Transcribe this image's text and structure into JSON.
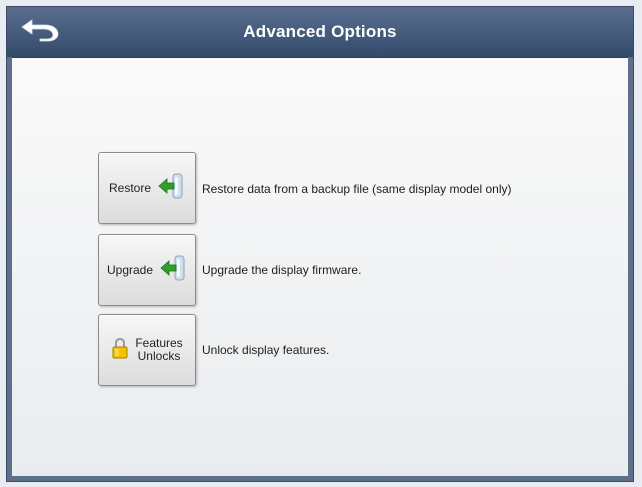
{
  "header": {
    "title": "Advanced Options",
    "back_icon": "back-arrow-icon"
  },
  "options": [
    {
      "label": "Restore",
      "icon": "import-arrow-icon",
      "description": "Restore data from a backup file (same display model only)"
    },
    {
      "label": "Upgrade",
      "icon": "import-arrow-icon",
      "description": "Upgrade the display firmware."
    },
    {
      "label_line1": "Features",
      "label_line2": "Unlocks",
      "icon": "padlock-icon",
      "description": "Unlock display features."
    }
  ],
  "colors": {
    "title_bar": "#344a6b",
    "arrow_green": "#2fa12a",
    "padlock_yellow": "#f2c400"
  }
}
